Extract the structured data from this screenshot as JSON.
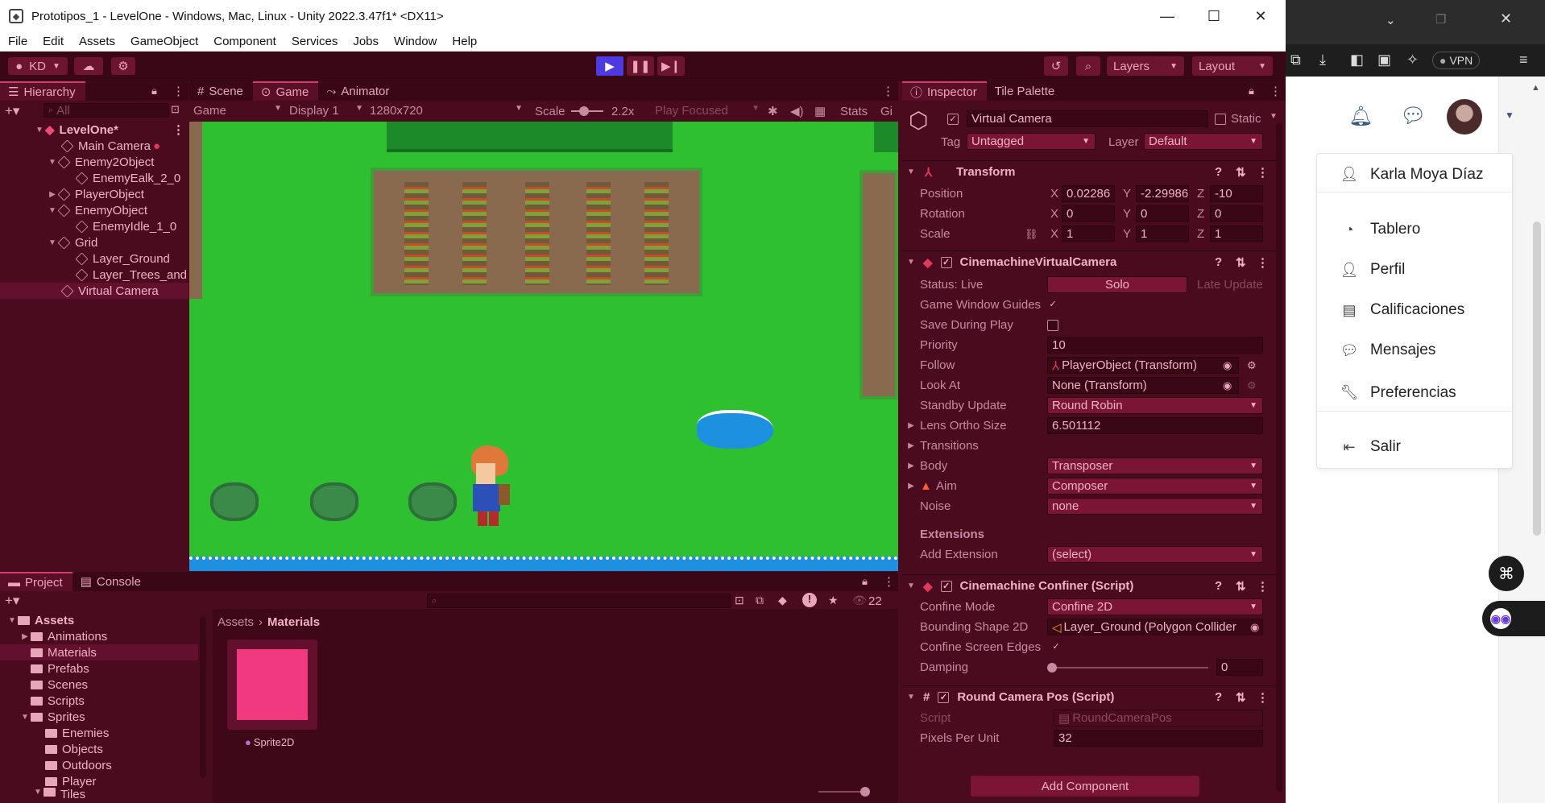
{
  "window": {
    "title": "Prototipos_1 - LevelOne - Windows, Mac, Linux - Unity 2022.3.47f1* <DX11>"
  },
  "menu": [
    "File",
    "Edit",
    "Assets",
    "GameObject",
    "Component",
    "Services",
    "Jobs",
    "Window",
    "Help"
  ],
  "toolbar": {
    "account": "KD",
    "layers": "Layers",
    "layout": "Layout"
  },
  "hierarchy": {
    "tab": "Hierarchy",
    "search_placeholder": "All",
    "items": [
      {
        "label": "LevelOne*",
        "indent": 0
      },
      {
        "label": "Main Camera",
        "indent": 1
      },
      {
        "label": "Enemy2Object",
        "indent": 1
      },
      {
        "label": "EnemyEalk_2_0",
        "indent": 2
      },
      {
        "label": "PlayerObject",
        "indent": 1
      },
      {
        "label": "EnemyObject",
        "indent": 1
      },
      {
        "label": "EnemyIdle_1_0",
        "indent": 2
      },
      {
        "label": "Grid",
        "indent": 1
      },
      {
        "label": "Layer_Ground",
        "indent": 2
      },
      {
        "label": "Layer_Trees_and",
        "indent": 2
      },
      {
        "label": "Virtual Camera",
        "indent": 1
      }
    ]
  },
  "viewtabs": {
    "scene": "Scene",
    "game": "Game",
    "animator": "Animator"
  },
  "gamebar": {
    "mode": "Game",
    "display": "Display 1",
    "resolution": "1280x720",
    "scale_label": "Scale",
    "scale_value": "2.2x",
    "play_focused": "Play Focused",
    "stats": "Stats",
    "gizmos": "Gi"
  },
  "inspector": {
    "tabs": {
      "inspector": "Inspector",
      "tile_palette": "Tile Palette"
    },
    "object_name": "Virtual Camera",
    "static_label": "Static",
    "tag_label": "Tag",
    "tag_value": "Untagged",
    "layer_label": "Layer",
    "layer_value": "Default",
    "transform": {
      "title": "Transform",
      "position_label": "Position",
      "position": [
        "0.02286",
        "-2.29986",
        "-10"
      ],
      "rotation_label": "Rotation",
      "rotation": [
        "0",
        "0",
        "0"
      ],
      "scale_label": "Scale",
      "scale": [
        "1",
        "1",
        "1"
      ]
    },
    "vcam": {
      "title": "CinemachineVirtualCamera",
      "status_label": "Status: Live",
      "solo": "Solo",
      "late_update": "Late Update",
      "guides_label": "Game Window Guides",
      "save_label": "Save During Play",
      "priority_label": "Priority",
      "priority": "10",
      "follow_label": "Follow",
      "follow": "PlayerObject (Transform)",
      "lookat_label": "Look At",
      "lookat": "None (Transform)",
      "standby_label": "Standby Update",
      "standby": "Round Robin",
      "lens_label": "Lens Ortho Size",
      "lens": "6.501112",
      "transitions_label": "Transitions",
      "body_label": "Body",
      "body": "Transposer",
      "aim_label": "Aim",
      "aim": "Composer",
      "noise_label": "Noise",
      "noise": "none",
      "extensions_label": "Extensions",
      "add_ext_label": "Add Extension",
      "add_ext": "(select)"
    },
    "confiner": {
      "title": "Cinemachine Confiner (Script)",
      "mode_label": "Confine Mode",
      "mode": "Confine 2D",
      "shape_label": "Bounding Shape 2D",
      "shape": "Layer_Ground (Polygon Collider",
      "edges_label": "Confine Screen Edges",
      "damping_label": "Damping",
      "damping": "0"
    },
    "roundpos": {
      "title": "Round Camera Pos (Script)",
      "script_label": "Script",
      "script": "RoundCameraPos",
      "ppu_label": "Pixels Per Unit",
      "ppu": "32"
    },
    "add_component": "Add Component"
  },
  "project": {
    "tabs": {
      "project": "Project",
      "console": "Console"
    },
    "badge": "22",
    "tree": [
      {
        "label": "Assets",
        "indent": 0,
        "open": true
      },
      {
        "label": "Animations",
        "indent": 1
      },
      {
        "label": "Materials",
        "indent": 1
      },
      {
        "label": "Prefabs",
        "indent": 1
      },
      {
        "label": "Scenes",
        "indent": 1
      },
      {
        "label": "Scripts",
        "indent": 1
      },
      {
        "label": "Sprites",
        "indent": 1,
        "open": true
      },
      {
        "label": "Enemies",
        "indent": 2
      },
      {
        "label": "Objects",
        "indent": 2
      },
      {
        "label": "Outdoors",
        "indent": 2
      },
      {
        "label": "Player",
        "indent": 2
      },
      {
        "label": "Tiles",
        "indent": 2
      }
    ],
    "breadcrumb": [
      "Assets",
      "Materials"
    ],
    "asset": {
      "label": "Sprite2D",
      "color": "#f0397f"
    }
  },
  "browser": {
    "vpn": "VPN",
    "user_name": "Karla Moya Díaz",
    "menu": [
      {
        "label": "Tablero",
        "icon": "dashboard-icon"
      },
      {
        "label": "Perfil",
        "icon": "user-icon"
      },
      {
        "label": "Calificaciones",
        "icon": "gradebook-icon"
      },
      {
        "label": "Mensajes",
        "icon": "chat-icon"
      },
      {
        "label": "Preferencias",
        "icon": "wrench-icon"
      }
    ],
    "logout": "Salir"
  }
}
